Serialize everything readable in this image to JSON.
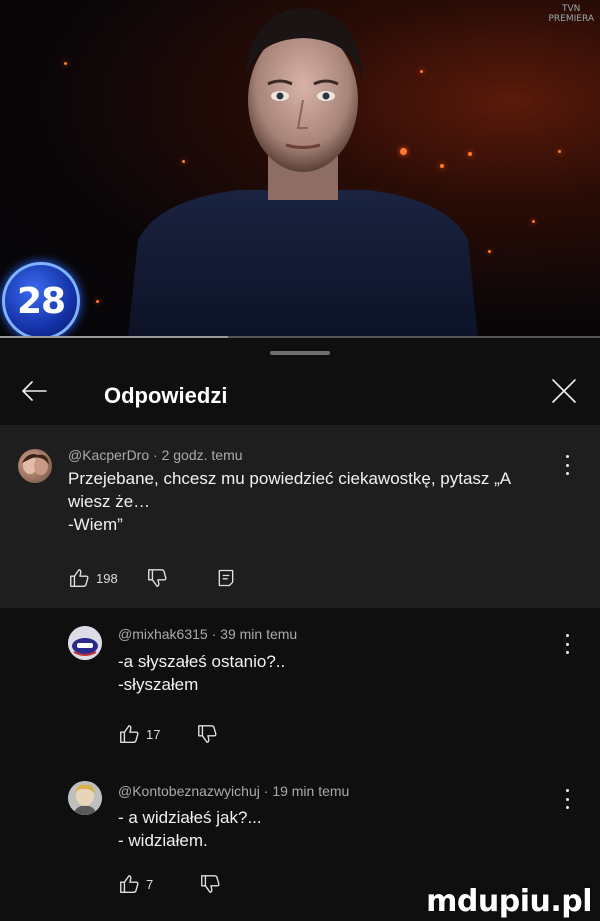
{
  "video": {
    "badge_number": "28",
    "channel_logo": "TVN",
    "channel_sub": "PREMIERA",
    "progress_fraction": 0.38
  },
  "panel": {
    "title": "Odpowiedzi",
    "back_icon": "arrow-left-icon",
    "close_icon": "close-icon"
  },
  "comments": [
    {
      "author": "@KacperDro",
      "time": "2 godz. temu",
      "text": "Przejebane, chcesz mu powiedzieć ciekawostkę, pytasz „A\nwiesz że…\n-Wiem”",
      "likes": "198"
    },
    {
      "author": "@mixhak6315",
      "time": "39 min temu",
      "text": "-a słyszałeś ostanio?..\n-słyszałem",
      "likes": "17"
    },
    {
      "author": "@Kontobeznazwyichuj",
      "time": "19 min temu",
      "text": "- a widziałeś jak?...\n- widziałem.",
      "likes": "7"
    }
  ],
  "watermark": "mdupiu.pl"
}
